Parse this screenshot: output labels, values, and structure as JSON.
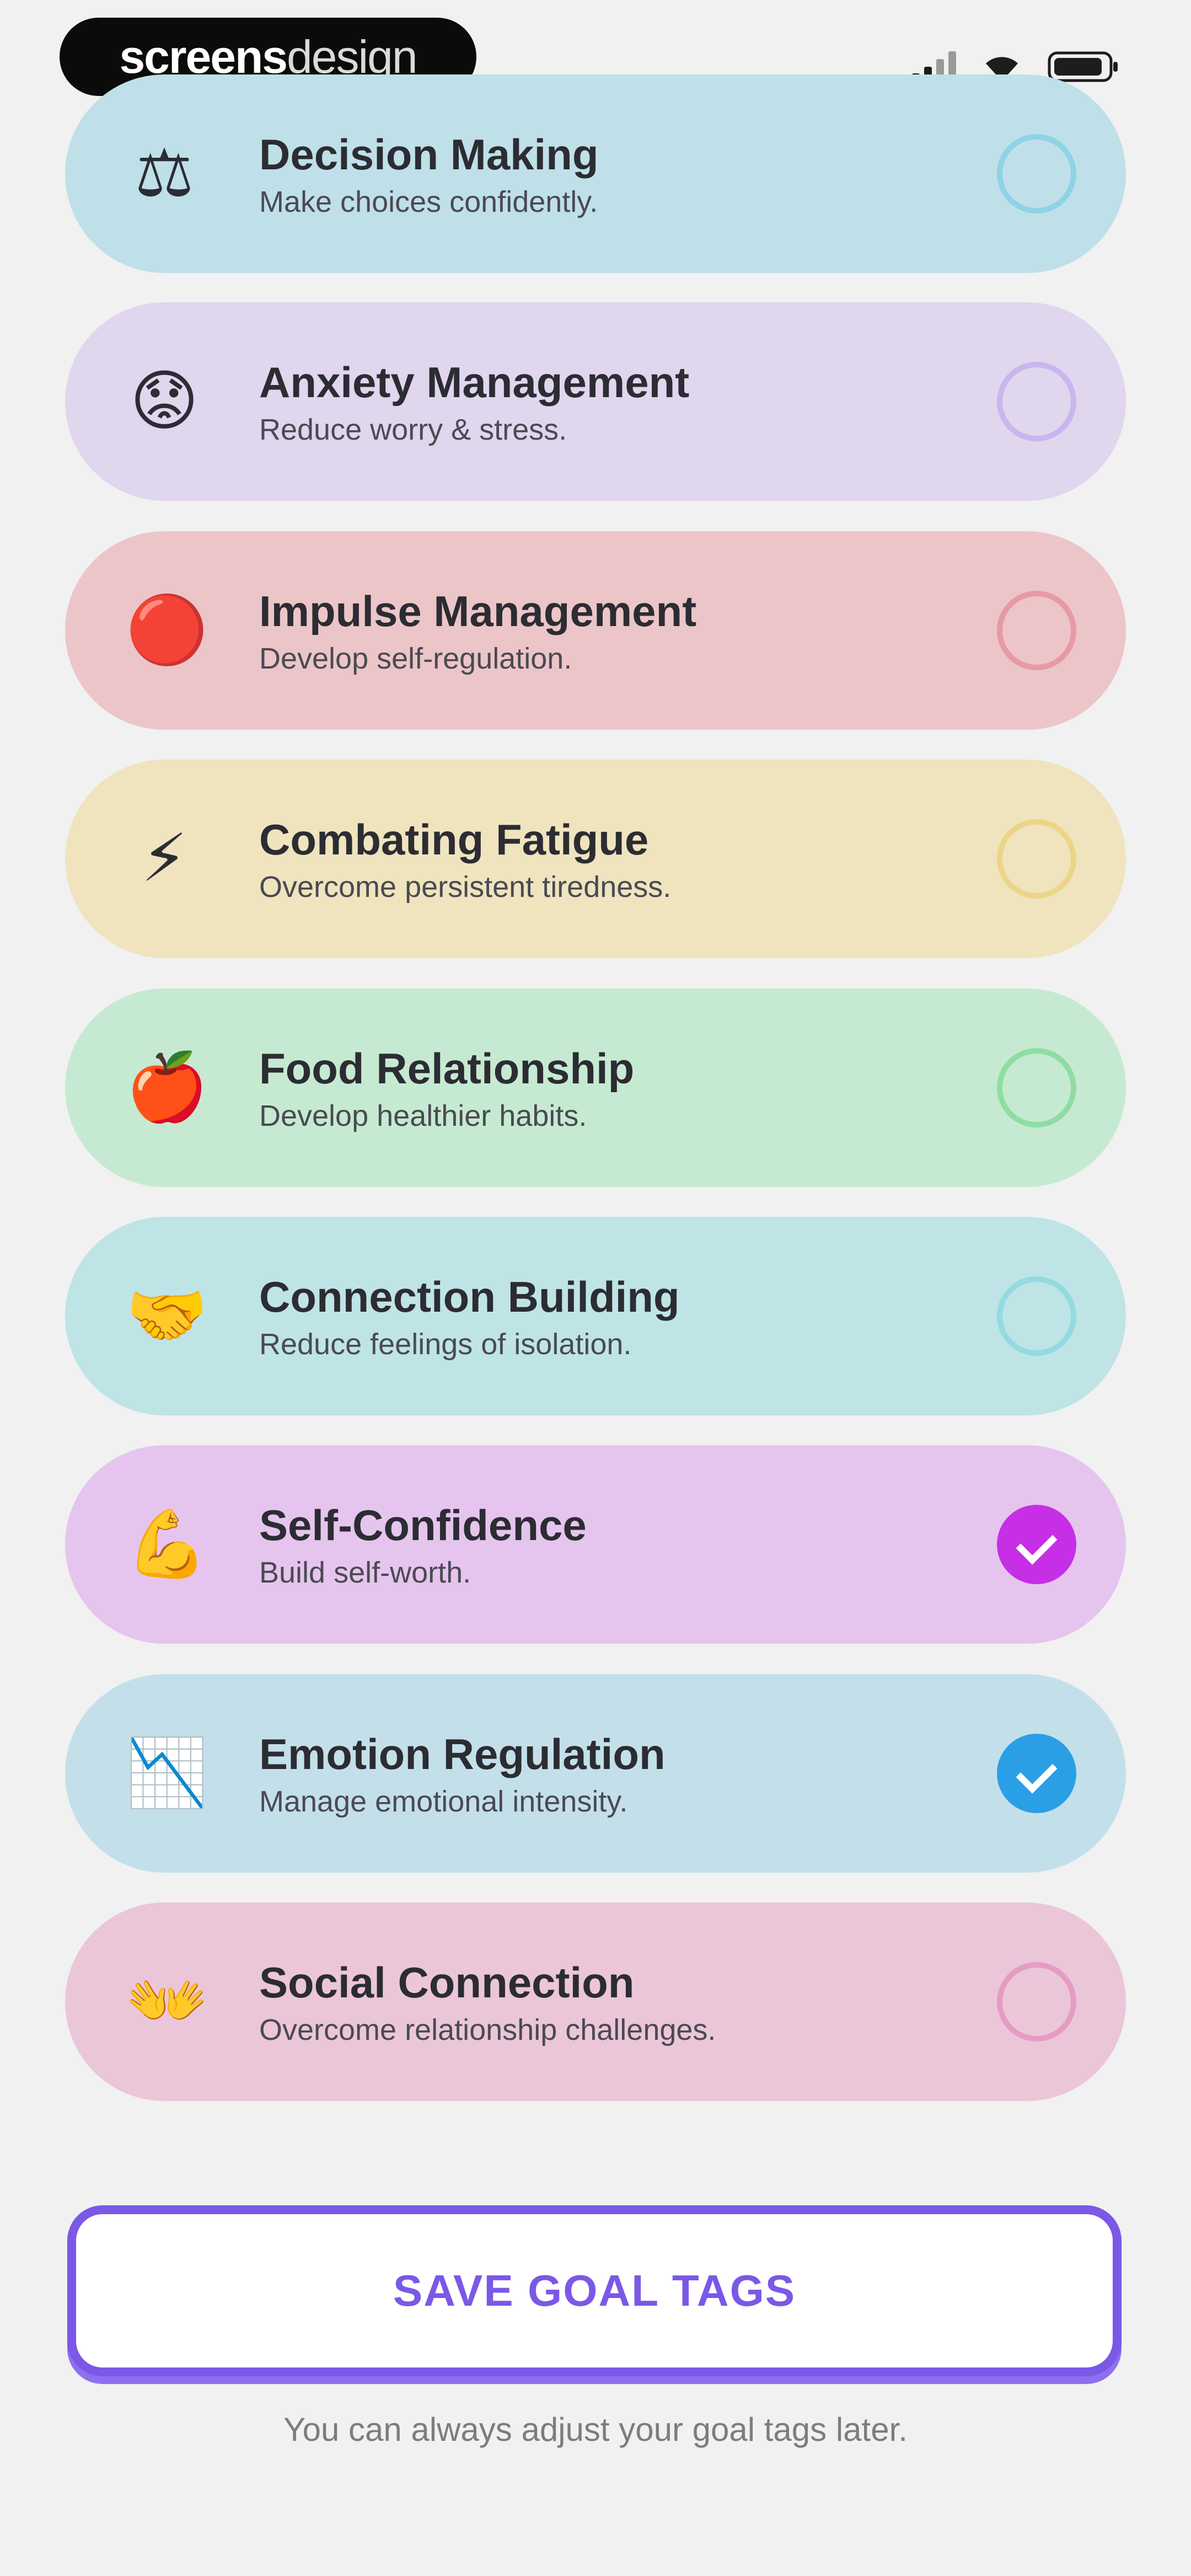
{
  "status_bar": {
    "brand_light": "screens",
    "brand_bold": "design",
    "signal_icon": "cellular-signal-icon",
    "wifi_icon": "wifi-icon",
    "battery_icon": "battery-icon"
  },
  "goals": [
    {
      "title": "Decision Making",
      "subtitle": "Make choices confidently.",
      "icon": "scales-icon",
      "glyph": "⚖",
      "bg": "#bfe0e8",
      "ring": "#8fd3e6",
      "fill": null,
      "selected": false
    },
    {
      "title": "Anxiety Management",
      "subtitle": "Reduce worry & stress.",
      "icon": "worried-face-icon",
      "glyph": "😟",
      "bg": "#e0d6ee",
      "ring": "#c8b6ee",
      "fill": null,
      "selected": false
    },
    {
      "title": "Impulse Management",
      "subtitle": "Develop self-regulation.",
      "icon": "red-circle-icon",
      "glyph": "🔴",
      "bg": "#ecc5c8",
      "ring": "#e79aa6",
      "fill": null,
      "selected": false
    },
    {
      "title": "Combating Fatigue",
      "subtitle": "Overcome persistent tiredness.",
      "icon": "lightning-icon",
      "glyph": "⚡",
      "bg": "#efe4be",
      "ring": "#ecd587",
      "fill": null,
      "selected": false
    },
    {
      "title": "Food Relationship",
      "subtitle": "Develop healthier habits.",
      "icon": "apple-icon",
      "glyph": "🍎",
      "bg": "#c6ead1",
      "ring": "#8fdda3",
      "fill": null,
      "selected": false
    },
    {
      "title": "Connection Building",
      "subtitle": "Reduce feelings of isolation.",
      "icon": "handshake-icon",
      "glyph": "🤝",
      "bg": "#bfe4e6",
      "ring": "#93dbe0",
      "fill": null,
      "selected": false
    },
    {
      "title": "Self-Confidence",
      "subtitle": "Build self-worth.",
      "icon": "flexed-biceps-icon",
      "glyph": "💪",
      "bg": "#e5c5ee",
      "ring": "#c62fe6",
      "fill": "#c62fe6",
      "selected": true
    },
    {
      "title": "Emotion Regulation",
      "subtitle": "Manage emotional intensity.",
      "icon": "chart-icon",
      "glyph": "📉",
      "bg": "#c3e0ea",
      "ring": "#2a9fe6",
      "fill": "#2a9fe6",
      "selected": true
    },
    {
      "title": "Social Connection",
      "subtitle": "Overcome relationship challenges.",
      "icon": "people-icon",
      "glyph": "👐",
      "bg": "#ebc6d8",
      "ring": "#e59cc4",
      "fill": null,
      "selected": false
    }
  ],
  "actions": {
    "save_label": "SAVE GOAL TAGS",
    "hint": "You can always adjust your goal tags later."
  },
  "colors": {
    "accent": "#7b58e6",
    "background": "#f1f1f1"
  }
}
